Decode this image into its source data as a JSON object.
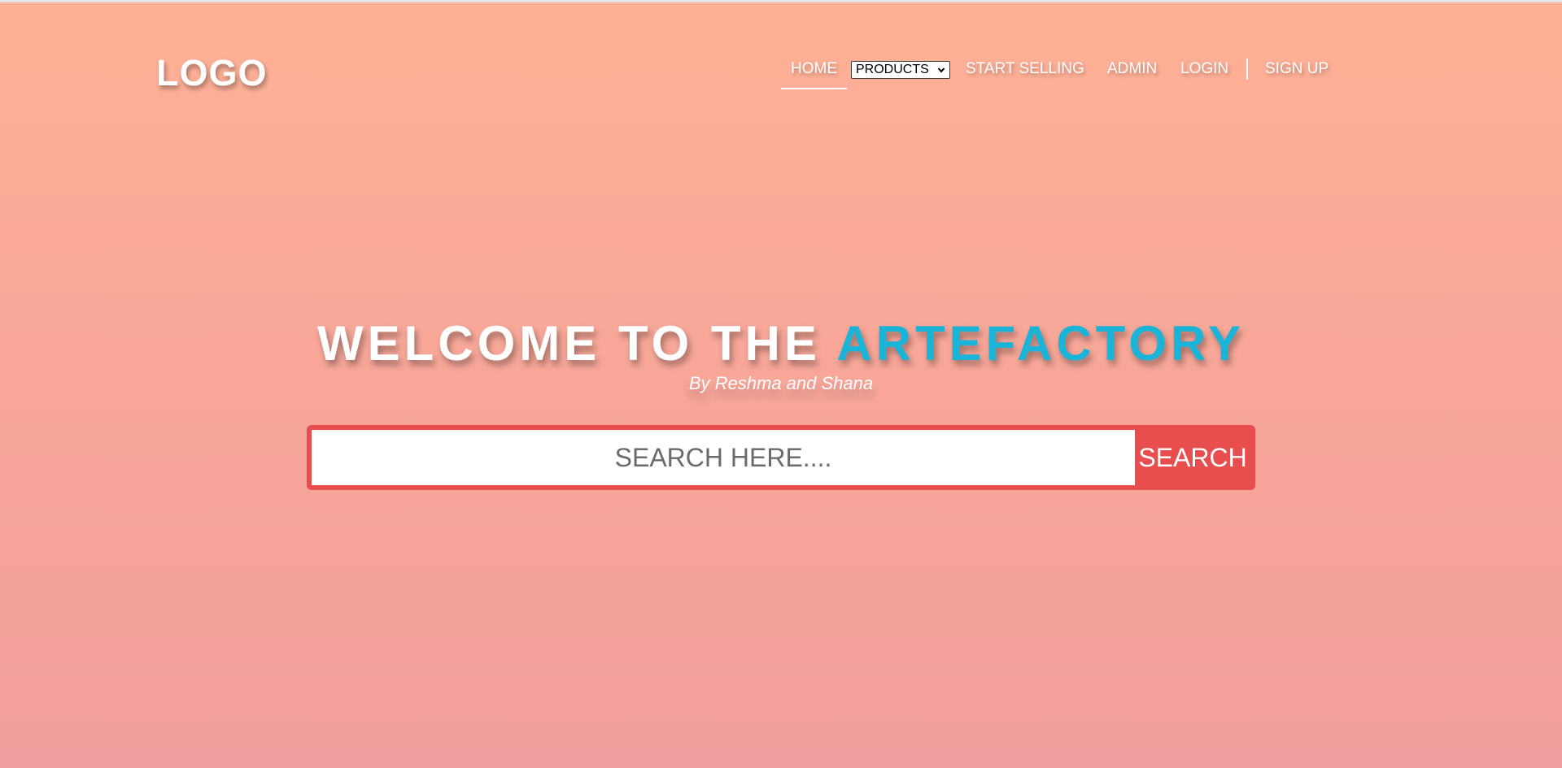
{
  "header": {
    "logo": "LOGO"
  },
  "nav": {
    "home": "HOME",
    "products_selected": "PRODUCTS",
    "start_selling": "START SELLING",
    "admin": "ADMIN",
    "login": "LOGIN",
    "sign_up": "SIGN UP",
    "active_item": "HOME"
  },
  "hero": {
    "title_prefix": "WELCOME TO THE ",
    "title_highlight": "ARTEFACTORY",
    "subtitle": "By Reshma and Shana"
  },
  "search": {
    "placeholder": "SEARCH HERE....",
    "value": "",
    "button_label": "SEARCH"
  },
  "colors": {
    "background_top": "#feb196",
    "background_bottom": "#f29f9f",
    "accent": "#1ab4d8",
    "search_red": "#e94e4f",
    "text": "#ffffff"
  }
}
